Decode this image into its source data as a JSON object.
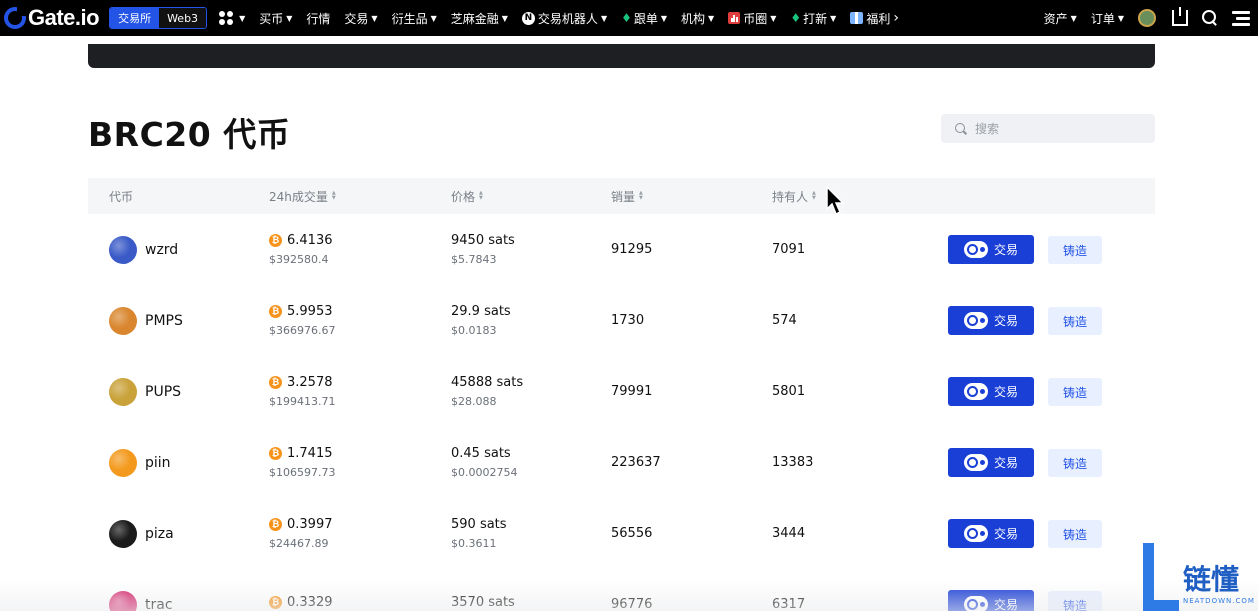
{
  "nav": {
    "logo_text": "Gate.io",
    "mode_tabs": [
      "交易所",
      "Web3"
    ],
    "items": [
      {
        "label": "买币",
        "icon": "",
        "caret": true
      },
      {
        "label": "行情",
        "icon": "",
        "caret": false
      },
      {
        "label": "交易",
        "icon": "",
        "caret": true
      },
      {
        "label": "衍生品",
        "icon": "",
        "caret": true
      },
      {
        "label": "芝麻金融",
        "icon": "",
        "caret": true
      },
      {
        "label": "交易机器人",
        "icon": "n-badge",
        "caret": true
      },
      {
        "label": "跟单",
        "icon": "flame",
        "caret": true
      },
      {
        "label": "机构",
        "icon": "",
        "caret": true
      },
      {
        "label": "币圈",
        "icon": "bar-chart",
        "caret": true
      },
      {
        "label": "打新",
        "icon": "flame",
        "caret": true
      },
      {
        "label": "福利",
        "icon": "gift",
        "caret": false,
        "chevron": "›"
      }
    ],
    "right": {
      "assets": "资产",
      "orders": "订单"
    }
  },
  "page": {
    "title": "BRC20 代币",
    "search_placeholder": "搜索"
  },
  "table": {
    "headers": {
      "token": "代币",
      "volume": "24h成交量",
      "price": "价格",
      "sales": "销量",
      "holders": "持有人"
    },
    "trade_label": "交易",
    "mint_label": "铸造",
    "rows": [
      {
        "name": "wzrd",
        "icon_color": "#3a5bc7",
        "vol_btc": "6.4136",
        "vol_usd": "$392580.4",
        "price_sats": "9450 sats",
        "price_usd": "$5.7843",
        "sales": "91295",
        "holders": "7091"
      },
      {
        "name": "PMPS",
        "icon_color": "#d9862e",
        "vol_btc": "5.9953",
        "vol_usd": "$366976.67",
        "price_sats": "29.9 sats",
        "price_usd": "$0.0183",
        "sales": "1730",
        "holders": "574"
      },
      {
        "name": "PUPS",
        "icon_color": "#c9a23a",
        "vol_btc": "3.2578",
        "vol_usd": "$199413.71",
        "price_sats": "45888 sats",
        "price_usd": "$28.088",
        "sales": "79991",
        "holders": "5801"
      },
      {
        "name": "piin",
        "icon_color": "#f39a1e",
        "vol_btc": "1.7415",
        "vol_usd": "$106597.73",
        "price_sats": "0.45 sats",
        "price_usd": "$0.0002754",
        "sales": "223637",
        "holders": "13383"
      },
      {
        "name": "piza",
        "icon_color": "#1b1b1b",
        "vol_btc": "0.3997",
        "vol_usd": "$24467.89",
        "price_sats": "590 sats",
        "price_usd": "$0.3611",
        "sales": "56556",
        "holders": "3444"
      },
      {
        "name": "trac",
        "icon_color": "#d4246b",
        "vol_btc": "0.3329",
        "vol_usd": "",
        "price_sats": "3570 sats",
        "price_usd": "",
        "sales": "96776",
        "holders": "6317"
      }
    ]
  },
  "watermark": {
    "cn": "链懂",
    "en": "NEATDOWN.COM"
  }
}
